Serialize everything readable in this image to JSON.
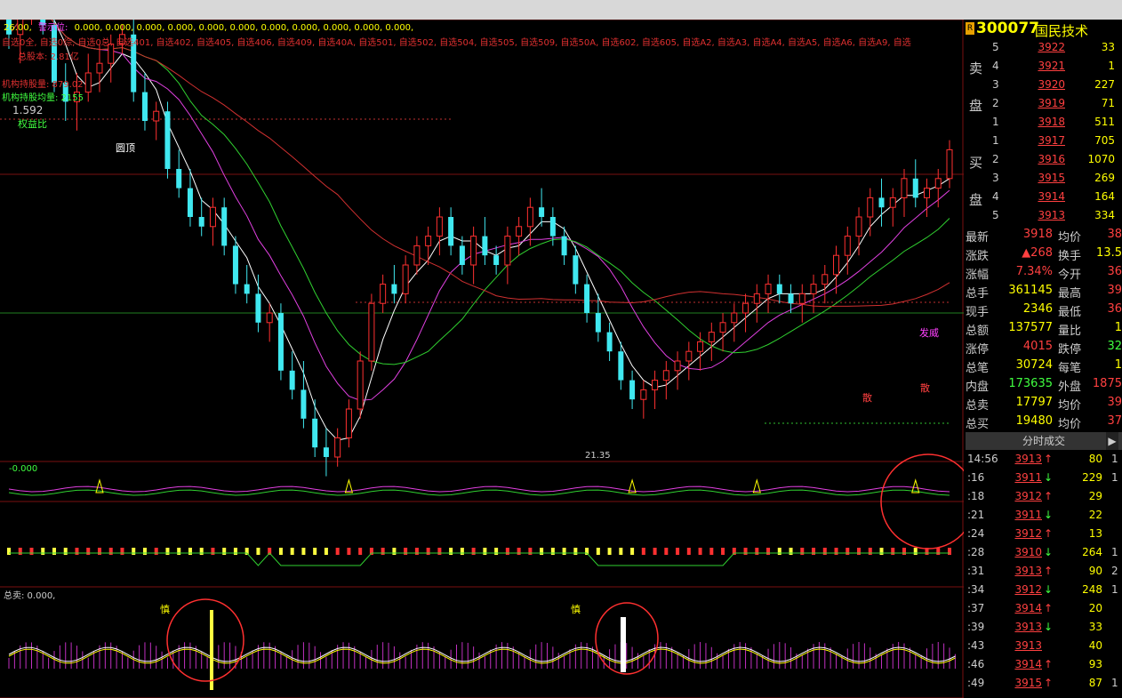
{
  "header": {
    "prefix": "26.00,",
    "alert_label": "警示位:",
    "alert_values": "0.000, 0.000, 0.000, 0.000, 0.000, 0.000, 0.000, 0.000, 0.000, 0.000, 0.000,"
  },
  "watchlist_text": "自选0全, 自选0综, 自选0总, 自选401, 自选402, 自选405, 自选406, 自选409, 自选40A, 自选501, 自选502, 自选504, 自选505, 自选509, 自选50A, 自选602, 自选605, 自选A2, 自选A3, 自选A4, 自选A5, 自选A6, 自选A9, 自选",
  "info": {
    "total_shares": "总股本: 2.81亿",
    "inst_hold": "机构持股量: 879.02",
    "inst_hold2": "机构持股均量: 2155",
    "ratio": "1.592",
    "ratio_tag": "权益比"
  },
  "chart_labels": {
    "round_top": "圆顶",
    "low_price": "21.35",
    "sub1_label": "-0.000",
    "sub3_label": "总卖: 0.000,",
    "fire_label": "发威",
    "sell_label": "散",
    "care_label": "慎"
  },
  "stock": {
    "badge": "R",
    "code": "300077",
    "name": "国民技术"
  },
  "order_book": {
    "sell_side_label_1": "卖",
    "sell_side_label_2": "盘",
    "buy_side_label_1": "买",
    "buy_side_label_2": "盘",
    "sell": [
      {
        "level": "5",
        "price": "3922",
        "volume": "33"
      },
      {
        "level": "4",
        "price": "3921",
        "volume": "1"
      },
      {
        "level": "3",
        "price": "3920",
        "volume": "227"
      },
      {
        "level": "2",
        "price": "3919",
        "volume": "71"
      },
      {
        "level": "1",
        "price": "3918",
        "volume": "511"
      }
    ],
    "buy": [
      {
        "level": "1",
        "price": "3917",
        "volume": "705"
      },
      {
        "level": "2",
        "price": "3916",
        "volume": "1070"
      },
      {
        "level": "3",
        "price": "3915",
        "volume": "269"
      },
      {
        "level": "4",
        "price": "3914",
        "volume": "164"
      },
      {
        "level": "5",
        "price": "3913",
        "volume": "334"
      }
    ]
  },
  "quote": [
    {
      "l1": "最新",
      "v1": "3918",
      "c1": "#ff4040",
      "l2": "均价",
      "v2": "38",
      "c2": "#ff4040"
    },
    {
      "l1": "涨跌",
      "v1": "▲268",
      "c1": "#ff4040",
      "l2": "换手",
      "v2": "13.5",
      "c2": "#ffff00"
    },
    {
      "l1": "涨幅",
      "v1": "7.34%",
      "c1": "#ff4040",
      "l2": "今开",
      "v2": "36",
      "c2": "#ff4040"
    },
    {
      "l1": "总手",
      "v1": "361145",
      "c1": "#ffff00",
      "l2": "最高",
      "v2": "39",
      "c2": "#ff4040"
    },
    {
      "l1": "现手",
      "v1": "2346",
      "c1": "#ffff00",
      "l2": "最低",
      "v2": "36",
      "c2": "#ff4040"
    },
    {
      "l1": "总额",
      "v1": "137577",
      "c1": "#ffff00",
      "l2": "量比",
      "v2": "1",
      "c2": "#ffff00"
    },
    {
      "l1": "涨停",
      "v1": "4015",
      "c1": "#ff4040",
      "l2": "跌停",
      "v2": "32",
      "c2": "#40ff40"
    },
    {
      "l1": "总笔",
      "v1": "30724",
      "c1": "#ffff00",
      "l2": "每笔",
      "v2": "1",
      "c2": "#ffff00"
    },
    {
      "l1": "内盘",
      "v1": "173635",
      "c1": "#40ff40",
      "l2": "外盘",
      "v2": "1875",
      "c2": "#ff4040"
    },
    {
      "l1": "总卖",
      "v1": "17797",
      "c1": "#ffff00",
      "l2": "均价",
      "v2": "39",
      "c2": "#ff4040"
    },
    {
      "l1": "总买",
      "v1": "19480",
      "c1": "#ffff00",
      "l2": "均价",
      "v2": "37",
      "c2": "#ff4040"
    }
  ],
  "ticks_tab": {
    "label": "分时成交",
    "arrow": "▶"
  },
  "ticks": [
    {
      "time": "14:56",
      "price": "3913",
      "dir": "↑",
      "vol": "80",
      "n": "1"
    },
    {
      "time": ":16",
      "price": "3911",
      "dir": "↓",
      "vol": "229",
      "n": "1"
    },
    {
      "time": ":18",
      "price": "3912",
      "dir": "↑",
      "vol": "29",
      "n": ""
    },
    {
      "time": ":21",
      "price": "3911",
      "dir": "↓",
      "vol": "22",
      "n": ""
    },
    {
      "time": ":24",
      "price": "3912",
      "dir": "↑",
      "vol": "13",
      "n": ""
    },
    {
      "time": ":28",
      "price": "3910",
      "dir": "↓",
      "vol": "264",
      "n": "1"
    },
    {
      "time": ":31",
      "price": "3913",
      "dir": "↑",
      "vol": "90",
      "n": "2"
    },
    {
      "time": ":34",
      "price": "3912",
      "dir": "↓",
      "vol": "248",
      "n": "1"
    },
    {
      "time": ":37",
      "price": "3914",
      "dir": "↑",
      "vol": "20",
      "n": ""
    },
    {
      "time": ":39",
      "price": "3913",
      "dir": "↓",
      "vol": "33",
      "n": ""
    },
    {
      "time": ":43",
      "price": "3913",
      "dir": "",
      "vol": "40",
      "n": ""
    },
    {
      "time": ":46",
      "price": "3914",
      "dir": "↑",
      "vol": "93",
      "n": ""
    },
    {
      "time": ":49",
      "price": "3915",
      "dir": "↑",
      "vol": "87",
      "n": "1"
    }
  ],
  "candles": [
    [
      62,
      70,
      55,
      58
    ],
    [
      58,
      66,
      52,
      64
    ],
    [
      64,
      76,
      60,
      72
    ],
    [
      72,
      72,
      58,
      60
    ],
    [
      60,
      62,
      46,
      48
    ],
    [
      48,
      52,
      40,
      44
    ],
    [
      44,
      50,
      38,
      46
    ],
    [
      46,
      54,
      44,
      50
    ],
    [
      50,
      56,
      46,
      52
    ],
    [
      52,
      58,
      48,
      56
    ],
    [
      56,
      60,
      54,
      58
    ],
    [
      58,
      62,
      44,
      46
    ],
    [
      46,
      50,
      38,
      40
    ],
    [
      40,
      44,
      36,
      42
    ],
    [
      42,
      44,
      28,
      30
    ],
    [
      30,
      34,
      24,
      26
    ],
    [
      26,
      30,
      18,
      20
    ],
    [
      20,
      24,
      16,
      18
    ],
    [
      18,
      24,
      14,
      22
    ],
    [
      22,
      24,
      12,
      14
    ],
    [
      14,
      16,
      4,
      6
    ],
    [
      6,
      10,
      2,
      4
    ],
    [
      4,
      8,
      -4,
      -2
    ],
    [
      -2,
      2,
      -6,
      0
    ],
    [
      0,
      2,
      -14,
      -12
    ],
    [
      -12,
      -8,
      -18,
      -16
    ],
    [
      -16,
      -10,
      -24,
      -22
    ],
    [
      -22,
      -18,
      -30,
      -28
    ],
    [
      -28,
      -24,
      -34,
      -30
    ],
    [
      -30,
      -24,
      -32,
      -26
    ],
    [
      -26,
      -18,
      -28,
      -20
    ],
    [
      -20,
      -8,
      -22,
      -10
    ],
    [
      -10,
      4,
      -12,
      2
    ],
    [
      2,
      8,
      0,
      6
    ],
    [
      6,
      10,
      2,
      4
    ],
    [
      4,
      12,
      2,
      10
    ],
    [
      10,
      16,
      8,
      14
    ],
    [
      14,
      18,
      10,
      16
    ],
    [
      16,
      22,
      12,
      20
    ],
    [
      20,
      22,
      12,
      14
    ],
    [
      14,
      16,
      8,
      10
    ],
    [
      10,
      18,
      6,
      16
    ],
    [
      16,
      20,
      10,
      12
    ],
    [
      12,
      14,
      8,
      10
    ],
    [
      10,
      18,
      6,
      16
    ],
    [
      16,
      20,
      12,
      18
    ],
    [
      18,
      24,
      14,
      22
    ],
    [
      22,
      26,
      18,
      20
    ],
    [
      20,
      22,
      14,
      16
    ],
    [
      16,
      18,
      10,
      12
    ],
    [
      12,
      14,
      4,
      6
    ],
    [
      6,
      8,
      -2,
      0
    ],
    [
      0,
      4,
      -6,
      -4
    ],
    [
      -4,
      -2,
      -10,
      -8
    ],
    [
      -8,
      -6,
      -16,
      -14
    ],
    [
      -14,
      -12,
      -20,
      -18
    ],
    [
      -18,
      -14,
      -22,
      -16
    ],
    [
      -16,
      -12,
      -20,
      -14
    ],
    [
      -14,
      -10,
      -18,
      -12
    ],
    [
      -12,
      -8,
      -16,
      -10
    ],
    [
      -10,
      -6,
      -14,
      -8
    ],
    [
      -8,
      -4,
      -12,
      -6
    ],
    [
      -6,
      -2,
      -10,
      -4
    ],
    [
      -4,
      0,
      -8,
      -2
    ],
    [
      -2,
      2,
      -6,
      0
    ],
    [
      0,
      4,
      -4,
      2
    ],
    [
      2,
      6,
      -2,
      4
    ],
    [
      4,
      8,
      0,
      6
    ],
    [
      6,
      8,
      2,
      4
    ],
    [
      4,
      6,
      0,
      2
    ],
    [
      2,
      6,
      -2,
      4
    ],
    [
      4,
      8,
      0,
      6
    ],
    [
      6,
      10,
      2,
      8
    ],
    [
      8,
      14,
      4,
      12
    ],
    [
      12,
      18,
      8,
      16
    ],
    [
      16,
      22,
      12,
      20
    ],
    [
      20,
      26,
      16,
      24
    ],
    [
      24,
      28,
      18,
      22
    ],
    [
      22,
      26,
      18,
      24
    ],
    [
      24,
      30,
      20,
      28
    ],
    [
      28,
      32,
      22,
      24
    ],
    [
      24,
      28,
      20,
      26
    ],
    [
      26,
      30,
      22,
      28
    ],
    [
      28,
      36,
      26,
      34
    ]
  ]
}
